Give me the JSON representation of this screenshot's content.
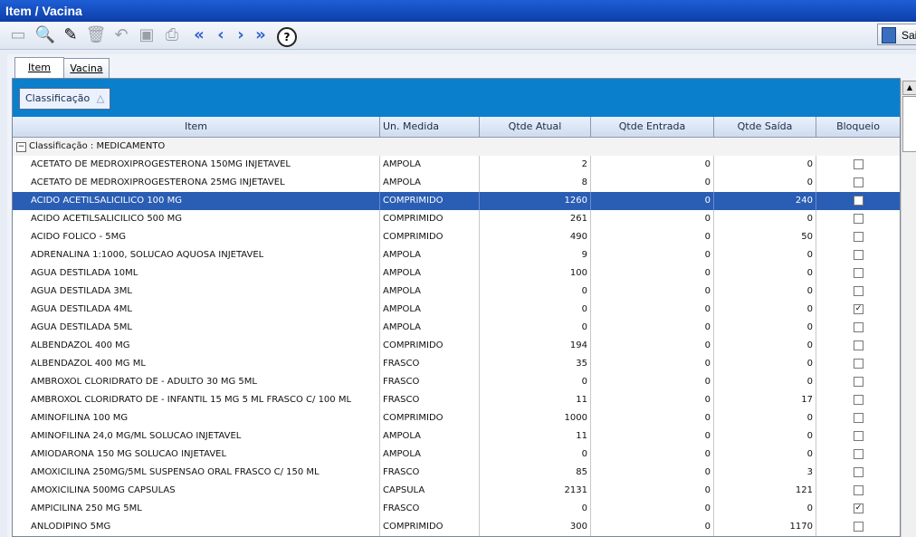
{
  "window": {
    "title": "Item / Vacina"
  },
  "toolbar": {
    "exit_label": "Sair",
    "icons": [
      "new-icon",
      "search-icon",
      "eraser-icon",
      "trash-icon",
      "undo-icon",
      "save-icon",
      "print-icon",
      "first-icon",
      "prev-icon",
      "next-icon",
      "last-icon",
      "help-icon"
    ]
  },
  "tabs": [
    {
      "label": "Item",
      "active": true
    },
    {
      "label": "Vacina",
      "active": false
    }
  ],
  "group_chip": {
    "label": "Classificação",
    "sort": "△"
  },
  "columns": [
    "Item",
    "Un. Medida",
    "Qtde Atual",
    "Qtde Entrada",
    "Qtde Saída",
    "Bloqueio"
  ],
  "group": {
    "expander": "−",
    "label": "Classificação : MEDICAMENTO"
  },
  "rows": [
    {
      "item": "ACETATO DE MEDROXIPROGESTERONA 150MG INJETAVEL",
      "un": "AMPOLA",
      "atual": "2",
      "entrada": "0",
      "saida": "0",
      "bloqueio": false
    },
    {
      "item": "ACETATO DE MEDROXIPROGESTERONA 25MG INJETAVEL",
      "un": "AMPOLA",
      "atual": "8",
      "entrada": "0",
      "saida": "0",
      "bloqueio": false
    },
    {
      "item": "ACIDO ACETILSALICILICO 100 MG",
      "un": "COMPRIMIDO",
      "atual": "1260",
      "entrada": "0",
      "saida": "240",
      "bloqueio": false,
      "selected": true
    },
    {
      "item": "ACIDO ACETILSALICILICO 500 MG",
      "un": "COMPRIMIDO",
      "atual": "261",
      "entrada": "0",
      "saida": "0",
      "bloqueio": false
    },
    {
      "item": "ACIDO FOLICO - 5MG",
      "un": "COMPRIMIDO",
      "atual": "490",
      "entrada": "0",
      "saida": "50",
      "bloqueio": false
    },
    {
      "item": "ADRENALINA 1:1000, SOLUCAO AQUOSA INJETAVEL",
      "un": "AMPOLA",
      "atual": "9",
      "entrada": "0",
      "saida": "0",
      "bloqueio": false
    },
    {
      "item": "AGUA DESTILADA 10ML",
      "un": "AMPOLA",
      "atual": "100",
      "entrada": "0",
      "saida": "0",
      "bloqueio": false
    },
    {
      "item": "AGUA DESTILADA 3ML",
      "un": "AMPOLA",
      "atual": "0",
      "entrada": "0",
      "saida": "0",
      "bloqueio": false
    },
    {
      "item": "AGUA DESTILADA 4ML",
      "un": "AMPOLA",
      "atual": "0",
      "entrada": "0",
      "saida": "0",
      "bloqueio": true
    },
    {
      "item": "AGUA DESTILADA 5ML",
      "un": "AMPOLA",
      "atual": "0",
      "entrada": "0",
      "saida": "0",
      "bloqueio": false
    },
    {
      "item": "ALBENDAZOL 400 MG",
      "un": "COMPRIMIDO",
      "atual": "194",
      "entrada": "0",
      "saida": "0",
      "bloqueio": false
    },
    {
      "item": "ALBENDAZOL 400 MG ML",
      "un": "FRASCO",
      "atual": "35",
      "entrada": "0",
      "saida": "0",
      "bloqueio": false
    },
    {
      "item": "AMBROXOL CLORIDRATO DE - ADULTO 30 MG 5ML",
      "un": "FRASCO",
      "atual": "0",
      "entrada": "0",
      "saida": "0",
      "bloqueio": false
    },
    {
      "item": "AMBROXOL CLORIDRATO DE - INFANTIL 15 MG 5 ML FRASCO C/ 100 ML",
      "un": "FRASCO",
      "atual": "11",
      "entrada": "0",
      "saida": "17",
      "bloqueio": false
    },
    {
      "item": "AMINOFILINA 100 MG",
      "un": "COMPRIMIDO",
      "atual": "1000",
      "entrada": "0",
      "saida": "0",
      "bloqueio": false
    },
    {
      "item": "AMINOFILINA 24,0 MG/ML SOLUCAO INJETAVEL",
      "un": "AMPOLA",
      "atual": "11",
      "entrada": "0",
      "saida": "0",
      "bloqueio": false
    },
    {
      "item": "AMIODARONA 150 MG SOLUCAO INJETAVEL",
      "un": "AMPOLA",
      "atual": "0",
      "entrada": "0",
      "saida": "0",
      "bloqueio": false
    },
    {
      "item": "AMOXICILINA 250MG/5ML SUSPENSAO ORAL FRASCO C/ 150 ML",
      "un": "FRASCO",
      "atual": "85",
      "entrada": "0",
      "saida": "3",
      "bloqueio": false
    },
    {
      "item": "AMOXICILINA 500MG CAPSULAS",
      "un": "CAPSULA",
      "atual": "2131",
      "entrada": "0",
      "saida": "121",
      "bloqueio": false
    },
    {
      "item": "AMPICILINA 250 MG 5ML",
      "un": "FRASCO",
      "atual": "0",
      "entrada": "0",
      "saida": "0",
      "bloqueio": true
    },
    {
      "item": "ANLODIPINO 5MG",
      "un": "COMPRIMIDO",
      "atual": "300",
      "entrada": "0",
      "saida": "1170",
      "bloqueio": false
    }
  ]
}
